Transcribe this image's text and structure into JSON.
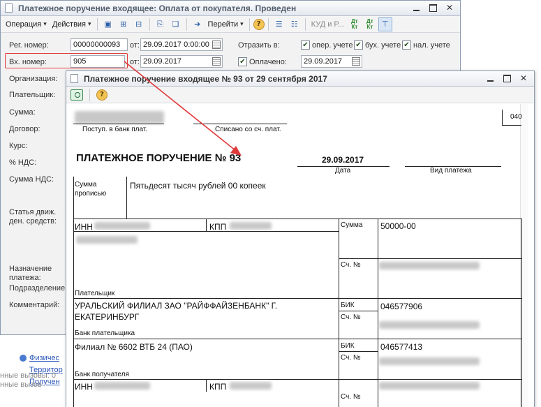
{
  "bg_window": {
    "title": "Платежное поручение входящее: Оплата от покупателя. Проведен",
    "toolbar": {
      "operation": "Операция",
      "actions": "Действия",
      "go": "Перейти",
      "kudir": "КУД и Р...",
      "dt_kt_1": "Дт Кт",
      "dt_kt_2": "Дт Кт"
    },
    "reg_label": "Рег. номер:",
    "reg_value": "00000000093",
    "from_label": "от:",
    "reg_date": "29.09.2017  0:00:00",
    "in_label": "Вх. номер:",
    "in_value": "905",
    "from_label2": "от:",
    "in_date": "29.09.2017",
    "reflect_label": "Отразить в:",
    "chk_oper": "опер. учете",
    "chk_buh": "бух. учете",
    "chk_nal": "нал. учете",
    "paid_label": "Оплачено:",
    "paid_date": "29.09.2017",
    "labels": {
      "org": "Организация:",
      "payer": "Плательщик:",
      "sum": "Сумма:",
      "contract": "Договор:",
      "rate": "Курс:",
      "vat_pct": "% НДС:",
      "vat_sum": "Сумма НДС:",
      "cashflow_1": "Статья движ.",
      "cashflow_2": "ден. средств:",
      "purpose_1": "Назначение",
      "purpose_2": "платежа:",
      "dept": "Подразделение",
      "comment": "Комментарий:"
    }
  },
  "outside": {
    "fizich": "Физичес",
    "territ": "Территор",
    "poluch": "Получен",
    "calls_1": "нные вызовы: 0",
    "calls_2": "нные вызов"
  },
  "fg_window": {
    "title": "Платежное поручение входящее № 93 от 29 сентября 2017",
    "form": {
      "code": "040",
      "received": "Поступ. в банк плат.",
      "debited": "Списано со сч. плат.",
      "heading": "ПЛАТЕЖНОЕ ПОРУЧЕНИЕ № 93",
      "date": "29.09.2017",
      "date_label": "Дата",
      "pay_type_label": "Вид платежа",
      "sum_words_label_1": "Сумма",
      "sum_words_label_2": "прописью",
      "sum_words": "Пятьдесят тысяч рублей 00 копеек",
      "inn": "ИНН",
      "kpp": "КПП",
      "sum_label": "Сумма",
      "sum_value": "50000-00",
      "acc_label_1": "Сч. №",
      "payer_label": "Плательщик",
      "bank_name_1": "УРАЛЬСКИЙ ФИЛИАЛ ЗАО \"РАЙФФАЙЗЕНБАНК\" Г.",
      "bank_name_2": "ЕКАТЕРИНБУРГ",
      "bik_label_1": "БИК",
      "bik_value_1": "046577906",
      "acc_label_2": "Сч. №",
      "payer_bank_label": "Банк плательщика",
      "rec_bank_name": "Филиал № 6602 ВТБ 24 (ПАО)",
      "bik_label_2": "БИК",
      "bik_value_2": "046577413",
      "acc_label_3": "Сч. №",
      "rec_bank_label": "Банк получателя",
      "inn_2": "ИНН",
      "kpp_2": "КПП",
      "acc_label_4": "Сч. №"
    }
  },
  "colors": {
    "highlight": "#e0393a",
    "arrow": "#e0393a"
  }
}
